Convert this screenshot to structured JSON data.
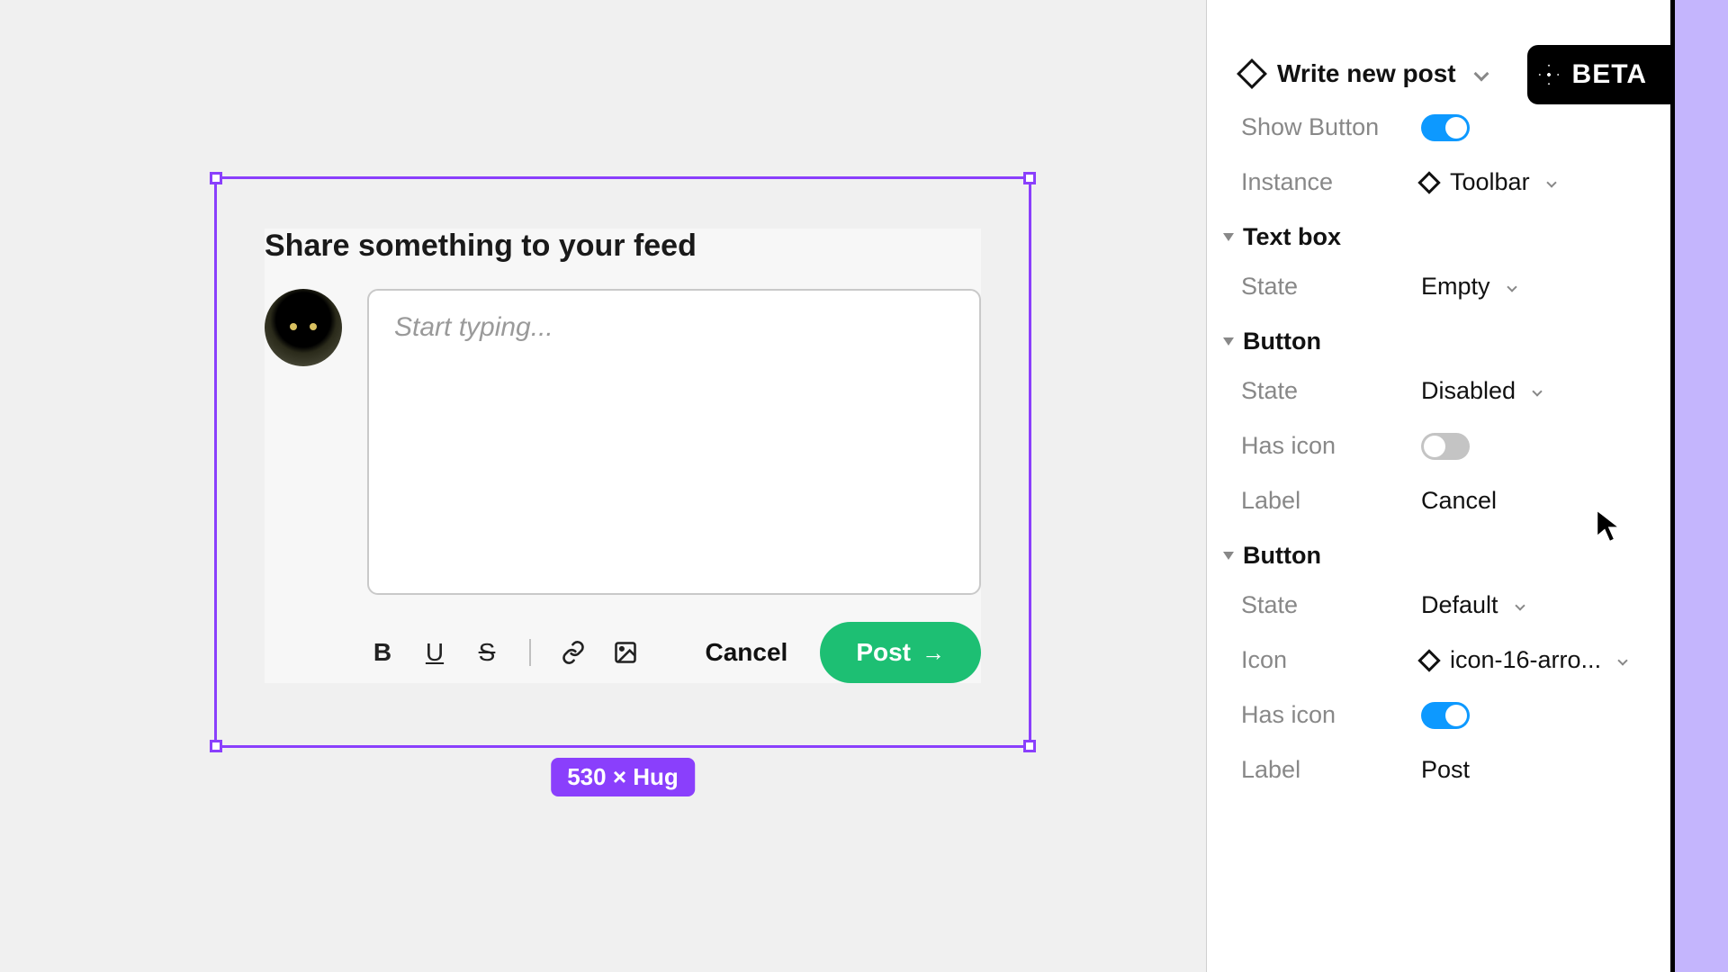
{
  "canvas": {
    "card_title": "Share something to your feed",
    "textbox_placeholder": "Start typing...",
    "cancel_label": "Cancel",
    "post_label": "Post",
    "post_arrow": "→",
    "size_badge": "530 × Hug"
  },
  "inspector": {
    "component_name": "Write new post",
    "show_button_label": "Show Button",
    "show_button_on": true,
    "instance_label": "Instance",
    "instance_value": "Toolbar",
    "sections": {
      "textbox": {
        "title": "Text box",
        "state_label": "State",
        "state_value": "Empty"
      },
      "button1": {
        "title": "Button",
        "state_label": "State",
        "state_value": "Disabled",
        "has_icon_label": "Has icon",
        "has_icon_on": false,
        "label_label": "Label",
        "label_value": "Cancel"
      },
      "button2": {
        "title": "Button",
        "state_label": "State",
        "state_value": "Default",
        "icon_label": "Icon",
        "icon_value": "icon-16-arro...",
        "has_icon_label": "Has icon",
        "has_icon_on": true,
        "label_label": "Label",
        "label_value": "Post"
      }
    }
  },
  "beta_label": "BETA"
}
